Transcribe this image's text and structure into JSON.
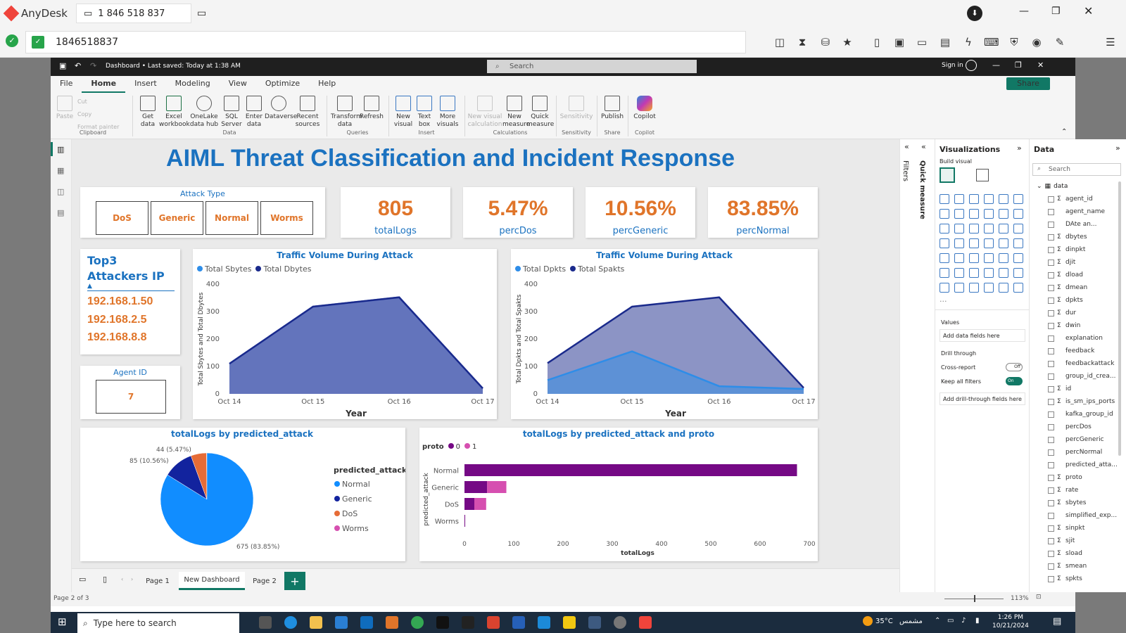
{
  "anydesk": {
    "app_name": "AnyDesk",
    "tab_label": "1 846 518 837",
    "address": "1846518837"
  },
  "pbi": {
    "title": "Dashboard • Last saved: Today at 1:38 AM",
    "search_placeholder": "Search",
    "sign_in": "Sign in",
    "share": "Share",
    "menu": [
      "File",
      "Home",
      "Insert",
      "Modeling",
      "View",
      "Optimize",
      "Help"
    ],
    "ribbon": {
      "paste": "Paste",
      "cut": "Cut",
      "copy": "Copy",
      "format_painter": "Format painter",
      "get_data": "Get data",
      "excel": "Excel workbook",
      "onelake": "OneLake data hub",
      "sql": "SQL Server",
      "enter_data": "Enter data",
      "dataverse": "Dataverse",
      "recent": "Recent sources",
      "transform": "Transform data",
      "refresh": "Refresh",
      "new_visual": "New visual",
      "text_box": "Text box",
      "more_visuals": "More visuals",
      "new_visual_calc": "New visual calculation",
      "new_measure": "New measure",
      "quick_measure": "Quick measure",
      "sensitivity": "Sensitivity",
      "publish": "Publish",
      "copilot": "Copilot",
      "groups": [
        "Clipboard",
        "Data",
        "Queries",
        "Insert",
        "Calculations",
        "Sensitivity",
        "Share",
        "Copilot"
      ]
    }
  },
  "dashboard": {
    "title": "AIML Threat Classification and Incident Response",
    "attack_type": {
      "label": "Attack Type",
      "options": [
        "DoS",
        "Generic",
        "Normal",
        "Worms"
      ]
    },
    "kpis": [
      {
        "value": "805",
        "label": "totalLogs"
      },
      {
        "value": "5.47%",
        "label": "percDos"
      },
      {
        "value": "10.56%",
        "label": "percGeneric"
      },
      {
        "value": "83.85%",
        "label": "percNormal"
      }
    ],
    "top3": {
      "title_line1": "Top3",
      "title_line2": "Attackers IP",
      "ips": [
        "192.168.1.50",
        "192.168.2.5",
        "192.168.8.8"
      ]
    },
    "agent": {
      "label": "Agent ID",
      "value": "7"
    },
    "tabs": [
      "Page 1",
      "New Dashboard",
      "Page 2"
    ],
    "status": "Page 2 of 3",
    "zoom": "113%"
  },
  "chart_data": [
    {
      "type": "area",
      "title": "Traffic Volume During Attack",
      "xlabel": "Year",
      "ylabel": "Total Sbytes and Total Dbytes",
      "x": [
        "Oct 14",
        "Oct 15",
        "Oct 16",
        "Oct 17"
      ],
      "x_positions": [
        0,
        0.33,
        0.67,
        1.0
      ],
      "ylim": [
        0,
        400
      ],
      "yticks": [
        "0",
        "100",
        "200",
        "300",
        "400"
      ],
      "series": [
        {
          "name": "Total Sbytes",
          "color": "#5b7fdc",
          "points": [
            [
              0,
              110
            ],
            [
              0.33,
              318
            ],
            [
              0.67,
              352
            ],
            [
              1.0,
              20
            ]
          ]
        },
        {
          "name": "Total Dbytes",
          "color": "#1a2a8c",
          "points": [
            [
              0,
              110
            ],
            [
              0.33,
              318
            ],
            [
              0.67,
              352
            ],
            [
              1.0,
              20
            ]
          ]
        }
      ]
    },
    {
      "type": "area",
      "title": "Traffic Volume During Attack",
      "xlabel": "Year",
      "ylabel": "Total Dpkts and Total Spakts",
      "x": [
        "Oct 14",
        "Oct 15",
        "Oct 16",
        "Oct 17"
      ],
      "x_positions": [
        0,
        0.33,
        0.67,
        1.0
      ],
      "ylim": [
        0,
        400
      ],
      "yticks": [
        "0",
        "100",
        "200",
        "300",
        "400"
      ],
      "series": [
        {
          "name": "Total Dpkts",
          "color": "#2e8de8",
          "points": [
            [
              0,
              50
            ],
            [
              0.33,
              155
            ],
            [
              0.67,
              28
            ],
            [
              1.0,
              18
            ]
          ]
        },
        {
          "name": "Total Spakts",
          "color": "#1a2a8c",
          "points": [
            [
              0,
              112
            ],
            [
              0.33,
              318
            ],
            [
              0.67,
              352
            ],
            [
              1.0,
              22
            ]
          ]
        }
      ]
    },
    {
      "type": "pie",
      "title": "totalLogs by predicted_attack",
      "legend_title": "predicted_attack",
      "slices": [
        {
          "name": "Normal",
          "value": 675,
          "label": "675 (83.85%)",
          "color": "#118dff"
        },
        {
          "name": "Generic",
          "value": 85,
          "label": "85 (10.56%)",
          "color": "#12239e"
        },
        {
          "name": "DoS",
          "value": 44,
          "label": "44 (5.47%)",
          "color": "#e66c37"
        },
        {
          "name": "Worms",
          "value": 1,
          "label": "",
          "color": "#d64fb0"
        }
      ]
    },
    {
      "type": "bar",
      "title": "totalLogs by predicted_attack and proto",
      "xlabel": "totalLogs",
      "ylabel": "predicted_attack",
      "legend_title": "proto",
      "categories": [
        "Normal",
        "Generic",
        "DoS",
        "Worms"
      ],
      "xlim": [
        0,
        700
      ],
      "xticks": [
        "0",
        "100",
        "200",
        "300",
        "400",
        "500",
        "600",
        "700"
      ],
      "series": [
        {
          "name": "0",
          "color": "#750985",
          "values": [
            675,
            46,
            20,
            1
          ]
        },
        {
          "name": "1",
          "color": "#d64fb0",
          "values": [
            0,
            39,
            24,
            0
          ]
        }
      ]
    }
  ],
  "visualizations": {
    "title": "Visualizations",
    "build": "Build visual",
    "values": "Values",
    "add_data": "Add data fields here",
    "drill": "Drill through",
    "cross": "Cross-report",
    "cross_state": "Off",
    "keep": "Keep all filters",
    "keep_state": "On",
    "add_drill": "Add drill-through fields here",
    "filters": "Filters",
    "quick": "Quick measure"
  },
  "data_pane": {
    "title": "Data",
    "search": "Search",
    "table": "data",
    "fields": [
      {
        "name": "agent_id",
        "sigma": true
      },
      {
        "name": "agent_name",
        "sigma": false
      },
      {
        "name": "DAte an...",
        "sigma": false
      },
      {
        "name": "dbytes",
        "sigma": true
      },
      {
        "name": "dinpkt",
        "sigma": true
      },
      {
        "name": "djit",
        "sigma": true
      },
      {
        "name": "dload",
        "sigma": true
      },
      {
        "name": "dmean",
        "sigma": true
      },
      {
        "name": "dpkts",
        "sigma": true
      },
      {
        "name": "dur",
        "sigma": true
      },
      {
        "name": "dwin",
        "sigma": true
      },
      {
        "name": "explanation",
        "sigma": false
      },
      {
        "name": "feedback",
        "sigma": false
      },
      {
        "name": "feedbackattack",
        "sigma": false
      },
      {
        "name": "group_id_crea...",
        "sigma": false
      },
      {
        "name": "id",
        "sigma": true
      },
      {
        "name": "is_sm_ips_ports",
        "sigma": true
      },
      {
        "name": "kafka_group_id",
        "sigma": false
      },
      {
        "name": "percDos",
        "sigma": false
      },
      {
        "name": "percGeneric",
        "sigma": false
      },
      {
        "name": "percNormal",
        "sigma": false
      },
      {
        "name": "predicted_atta...",
        "sigma": false
      },
      {
        "name": "proto",
        "sigma": true
      },
      {
        "name": "rate",
        "sigma": true
      },
      {
        "name": "sbytes",
        "sigma": true
      },
      {
        "name": "simplified_exp...",
        "sigma": false
      },
      {
        "name": "sinpkt",
        "sigma": true
      },
      {
        "name": "sjit",
        "sigma": true
      },
      {
        "name": "sload",
        "sigma": true
      },
      {
        "name": "smean",
        "sigma": true
      },
      {
        "name": "spkts",
        "sigma": true
      }
    ]
  },
  "taskbar": {
    "search": "Type here to search",
    "weather": "35°C",
    "weather_text": "مشمس",
    "time": "1:26 PM",
    "date": "10/21/2024"
  }
}
